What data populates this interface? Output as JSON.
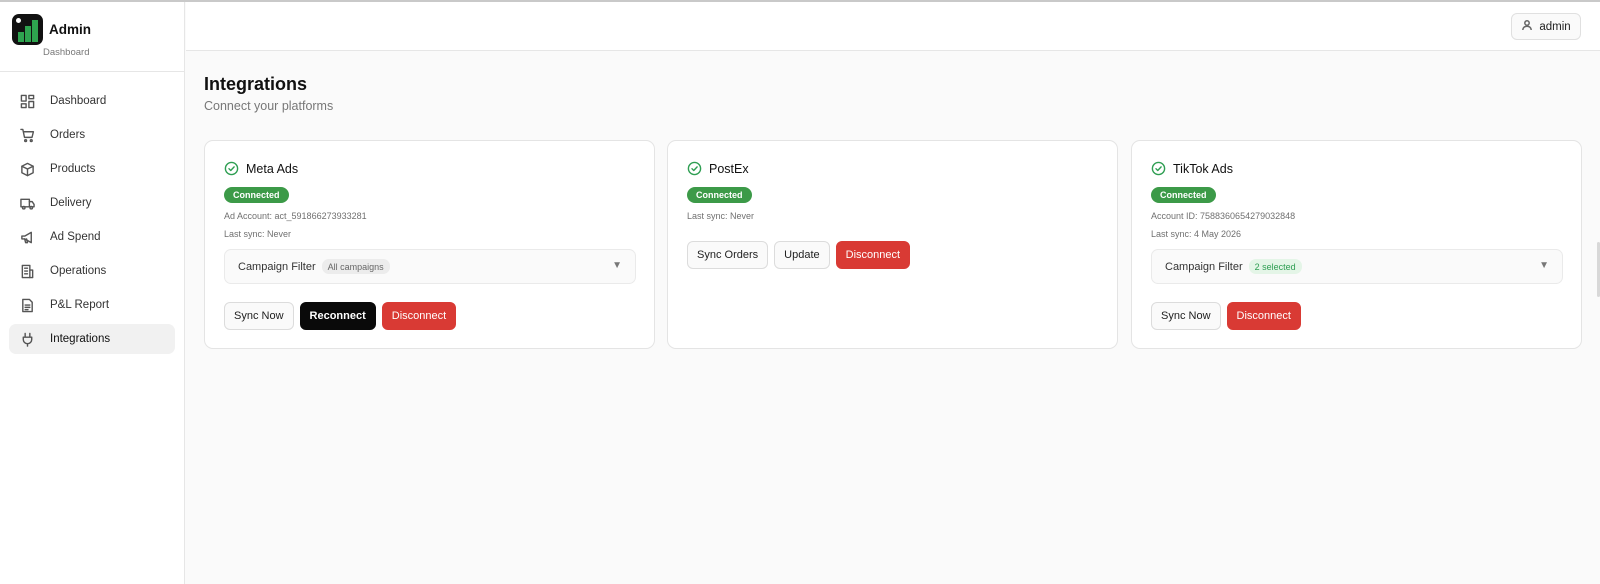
{
  "brand": {
    "title": "Admin",
    "subtitle": "Dashboard"
  },
  "sidebar": {
    "items": [
      {
        "label": "Dashboard",
        "icon": "dashboard-grid-icon"
      },
      {
        "label": "Orders",
        "icon": "shopping-cart-icon"
      },
      {
        "label": "Products",
        "icon": "package-icon"
      },
      {
        "label": "Delivery",
        "icon": "truck-icon"
      },
      {
        "label": "Ad Spend",
        "icon": "megaphone-icon"
      },
      {
        "label": "Operations",
        "icon": "building-icon"
      },
      {
        "label": "P&L Report",
        "icon": "report-icon"
      },
      {
        "label": "Integrations",
        "icon": "plug-icon",
        "active": true
      }
    ]
  },
  "header": {
    "user_label": "admin",
    "user_icon": "user-icon"
  },
  "page": {
    "title": "Integrations",
    "subtitle": "Connect your platforms"
  },
  "cards": [
    {
      "name": "Meta Ads",
      "status": "Connected",
      "meta_line_1": "Ad Account: act_591866273933281",
      "meta_line_2": "Last sync: Never",
      "filter_label": "Campaign Filter",
      "filter_value": "All campaigns",
      "actions": [
        "Sync Now",
        "Reconnect",
        "Disconnect"
      ]
    },
    {
      "name": "PostEx",
      "status": "Connected",
      "meta_line_1": "Last sync: Never",
      "actions": [
        "Sync Orders",
        "Update",
        "Disconnect"
      ]
    },
    {
      "name": "TikTok Ads",
      "status": "Connected",
      "meta_line_1": "Account ID: 7588360654279032848",
      "meta_line_2": "Last sync: 4 May 2026",
      "filter_label": "Campaign Filter",
      "filter_value": "2 selected",
      "actions": [
        "Sync Now",
        "Disconnect"
      ]
    }
  ],
  "colors": {
    "connected": "#3c9a48",
    "danger": "#d93a34",
    "primary": "#0a0a0a",
    "check": "#2e9e52"
  }
}
